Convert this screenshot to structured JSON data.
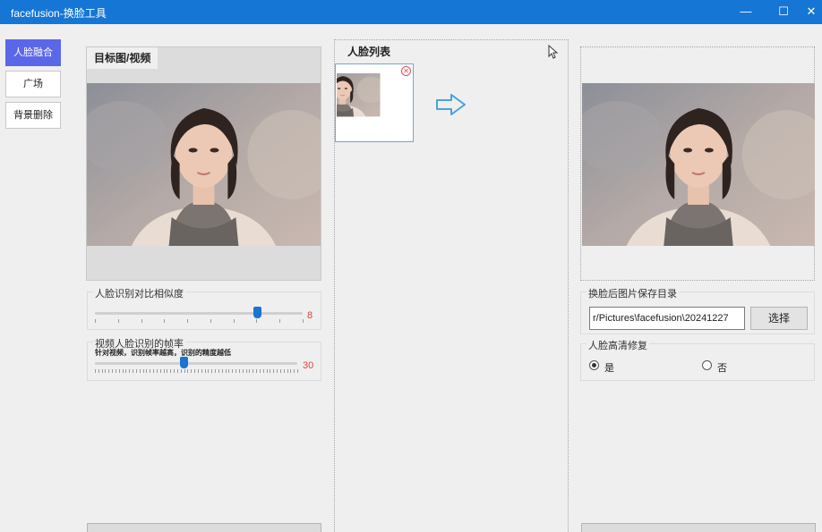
{
  "window": {
    "title": "facefusion-换脸工具",
    "minimize_glyph": "—",
    "maximize_glyph": "☐",
    "close_glyph": "✕"
  },
  "sidebar": {
    "items": [
      {
        "label": "人脸融合",
        "active": true
      },
      {
        "label": "广场",
        "active": false
      },
      {
        "label": "背景删除",
        "active": false
      }
    ]
  },
  "target": {
    "tab_label": "目标图/视频",
    "similarity": {
      "title": "人脸识别对比相似度",
      "value": "8",
      "level": 0.78
    },
    "fps": {
      "title": "视频人脸识别的帧率",
      "hint": "针对视频，识别帧率越高，识别的精度越低",
      "value": "30",
      "level": 0.44
    }
  },
  "face_list": {
    "tab_label": "人脸列表",
    "remove_glyph": "✕",
    "arrow_icon": "right-arrow-icon"
  },
  "output": {
    "save_dir_title": "换脸后图片保存目录",
    "save_dir_value": "r/Pictures\\facefusion\\20241227",
    "choose_button": "选择",
    "enhance_title": "人脸高清修复",
    "options": [
      {
        "label": "是",
        "selected": true
      },
      {
        "label": "否",
        "selected": false
      }
    ]
  },
  "colors": {
    "titlebar": "#1676d6",
    "active_tab": "#5a67e8",
    "slider_thumb": "#1a74d0",
    "slider_value": "#d9453c"
  }
}
